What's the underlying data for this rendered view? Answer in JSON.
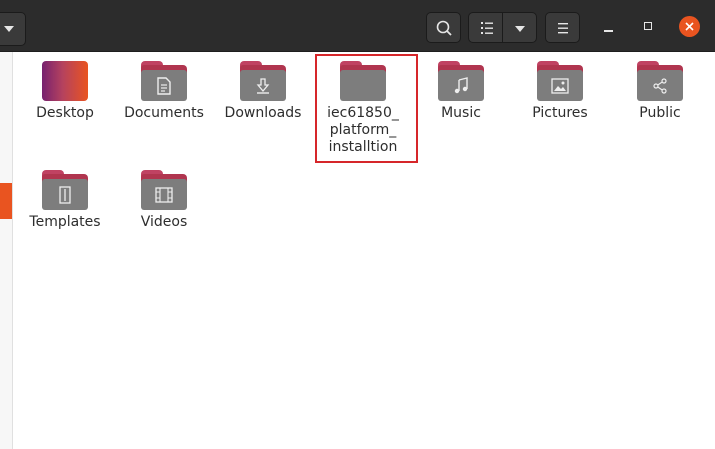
{
  "toolbar": {
    "icons": [
      "chevron-down-icon",
      "search-icon",
      "list-view-icon",
      "chevron-down-icon",
      "hamburger-menu-icon",
      "minimize-icon",
      "maximize-icon",
      "close-icon"
    ]
  },
  "accent_color": "#e95420",
  "folders": [
    {
      "label": "Desktop",
      "icon": "desktop-folder-icon"
    },
    {
      "label": "Documents",
      "icon": "document-icon"
    },
    {
      "label": "Downloads",
      "icon": "download-icon"
    },
    {
      "label": "iec61850_ platform_ installtion",
      "icon": "folder-icon"
    },
    {
      "label": "Music",
      "icon": "music-note-icon"
    },
    {
      "label": "Pictures",
      "icon": "image-icon"
    },
    {
      "label": "Public",
      "icon": "share-icon"
    },
    {
      "label": "Templates",
      "icon": "template-icon"
    },
    {
      "label": "Videos",
      "icon": "film-icon"
    }
  ]
}
